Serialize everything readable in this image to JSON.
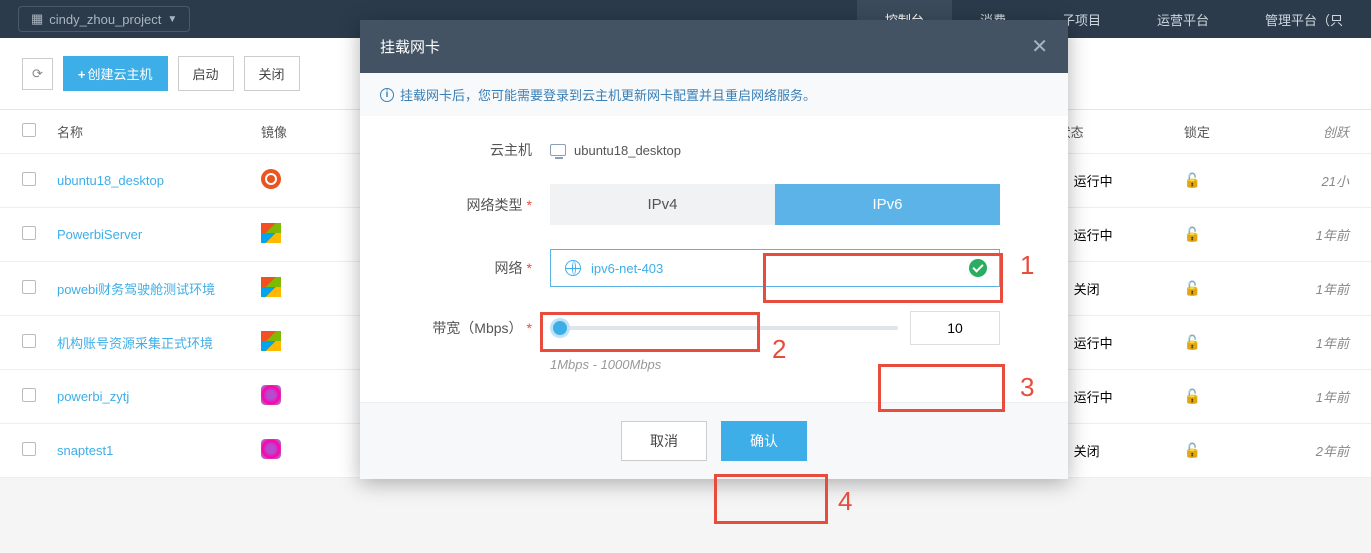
{
  "topnav": {
    "project_icon": "grid-icon",
    "project_name": "cindy_zhou_project",
    "items": [
      "控制台",
      "消费",
      "子项目",
      "运营平台",
      "管理平台（只"
    ],
    "active_idx": 0
  },
  "toolbar": {
    "refresh": "↻",
    "create_vm": "创建云主机",
    "start": "启动",
    "stop": "关闭"
  },
  "columns": {
    "name": "名称",
    "image": "镜像",
    "status": "状态",
    "lock": "锁定",
    "created": "创跃"
  },
  "rows": [
    {
      "name": "ubuntu18_desktop",
      "os": "ubuntu",
      "status": "运行中",
      "status_color": "green",
      "time": "21小"
    },
    {
      "name": "PowerbiServer",
      "os": "win",
      "status": "运行中",
      "status_color": "green",
      "time": "1年前"
    },
    {
      "name": "powebi财务驾驶舱测试环境",
      "os": "win",
      "status": "关闭",
      "status_color": "gray",
      "time": "1年前"
    },
    {
      "name": "机构账号资源采集正式环境",
      "os": "win",
      "status": "运行中",
      "status_color": "green",
      "time": "1年前"
    },
    {
      "name": "powerbi_zytj",
      "os": "other",
      "status": "运行中",
      "status_color": "green",
      "time": "1年前"
    },
    {
      "name": "snaptest1",
      "os": "other",
      "status": "关闭",
      "status_color": "gray",
      "time": "2年前"
    }
  ],
  "modal": {
    "title": "挂载网卡",
    "info": "挂载网卡后，您可能需要登录到云主机更新网卡配置并且重启网络服务。",
    "labels": {
      "vm": "云主机",
      "net_type": "网络类型",
      "network": "网络",
      "bandwidth": "带宽（Mbps）"
    },
    "vm_name": "ubuntu18_desktop",
    "net_types": {
      "ipv4": "IPv4",
      "ipv6": "IPv6"
    },
    "network_value": "ipv6-net-403",
    "bandwidth_value": "10",
    "bandwidth_hint": "1Mbps - 1000Mbps",
    "cancel": "取消",
    "confirm": "确认"
  },
  "callouts": {
    "1": "1",
    "2": "2",
    "3": "3",
    "4": "4"
  }
}
